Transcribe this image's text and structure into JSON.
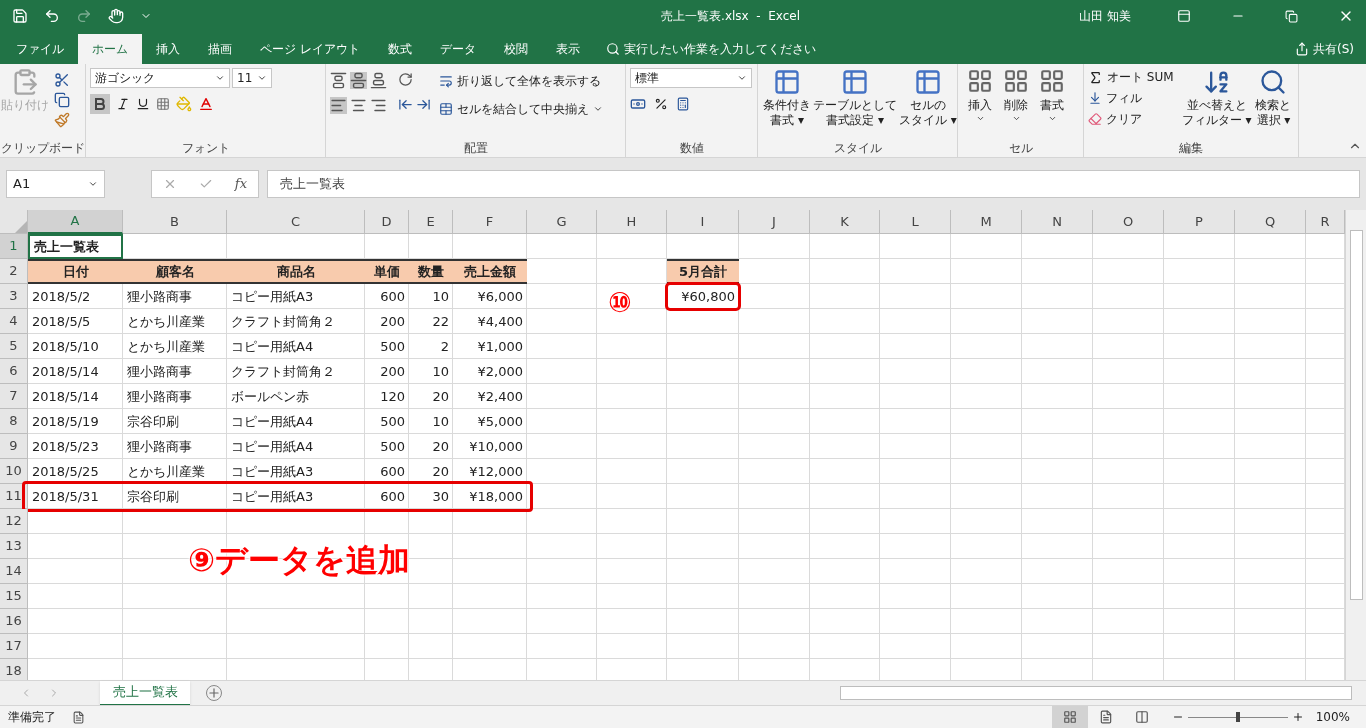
{
  "window": {
    "title": "売上一覧表.xlsx  -  Excel",
    "user": "山田 知美"
  },
  "menu_tabs": [
    {
      "label": "ファイル",
      "selected": false
    },
    {
      "label": "ホーム",
      "selected": true
    },
    {
      "label": "挿入",
      "selected": false
    },
    {
      "label": "描画",
      "selected": false
    },
    {
      "label": "ページ レイアウト",
      "selected": false
    },
    {
      "label": "数式",
      "selected": false
    },
    {
      "label": "データ",
      "selected": false
    },
    {
      "label": "校閲",
      "selected": false
    },
    {
      "label": "表示",
      "selected": false
    }
  ],
  "tell_me": "実行したい作業を入力してください",
  "share": "共有(S)",
  "ribbon": {
    "clipboard": {
      "paste": "貼り付け",
      "paste_disabled": true,
      "label": "クリップボード"
    },
    "font": {
      "name": "游ゴシック",
      "size": "11",
      "bold": true,
      "label": "フォント"
    },
    "alignment": {
      "wrap": "折り返して全体を表示する",
      "merge": "セルを結合して中央揃え",
      "label": "配置"
    },
    "number": {
      "format": "標準",
      "label": "数値"
    },
    "styles": {
      "buttons": [
        [
          "条件付き",
          "書式 ▾"
        ],
        [
          "テーブルとして",
          "書式設定 ▾"
        ],
        [
          "セルの",
          "スタイル ▾"
        ]
      ],
      "label": "スタイル"
    },
    "cells": {
      "buttons": [
        "挿入",
        "削除",
        "書式"
      ],
      "label": "セル"
    },
    "editing": {
      "autosum": "オート SUM",
      "fill": "フィル",
      "clear": "クリア",
      "sort": [
        "並べ替えと",
        "フィルター ▾"
      ],
      "find": [
        "検索と",
        "選択 ▾"
      ],
      "label": "編集"
    }
  },
  "formula_bar": {
    "name_box": "A1",
    "function_label": "fx",
    "formula": "売上一覧表"
  },
  "columns": [
    {
      "label": "A",
      "selected": true
    },
    {
      "label": "B",
      "selected": false
    },
    {
      "label": "C",
      "selected": false
    },
    {
      "label": "D",
      "selected": false
    },
    {
      "label": "E",
      "selected": false
    },
    {
      "label": "F",
      "selected": false
    },
    {
      "label": "G",
      "selected": false
    },
    {
      "label": "H",
      "selected": false
    },
    {
      "label": "I",
      "selected": false
    },
    {
      "label": "J",
      "selected": false
    },
    {
      "label": "K",
      "selected": false
    },
    {
      "label": "L",
      "selected": false
    },
    {
      "label": "M",
      "selected": false
    },
    {
      "label": "N",
      "selected": false
    },
    {
      "label": "O",
      "selected": false
    },
    {
      "label": "P",
      "selected": false
    },
    {
      "label": "Q",
      "selected": false
    },
    {
      "label": "R",
      "selected": false
    }
  ],
  "rows": [
    {
      "number": "1",
      "kind": "title",
      "selected": true,
      "highlighted": false,
      "cells": [
        "売上一覧表"
      ]
    },
    {
      "number": "2",
      "kind": "header",
      "selected": false,
      "highlighted": false,
      "cells": [
        "日付",
        "顧客名",
        "商品名",
        "単価",
        "数量",
        "売上金額"
      ]
    },
    {
      "number": "3",
      "kind": "data",
      "selected": false,
      "highlighted": false,
      "cells": [
        "2018/5/2",
        "狸小路商事",
        "コピー用紙A3",
        "600",
        "10",
        "¥6,000"
      ]
    },
    {
      "number": "4",
      "kind": "data",
      "selected": false,
      "highlighted": false,
      "cells": [
        "2018/5/5",
        "とかち川産業",
        "クラフト封筒角２",
        "200",
        "22",
        "¥4,400"
      ]
    },
    {
      "number": "5",
      "kind": "data",
      "selected": false,
      "highlighted": false,
      "cells": [
        "2018/5/10",
        "とかち川産業",
        "コピー用紙A4",
        "500",
        "2",
        "¥1,000"
      ]
    },
    {
      "number": "6",
      "kind": "data",
      "selected": false,
      "highlighted": false,
      "cells": [
        "2018/5/14",
        "狸小路商事",
        "クラフト封筒角２",
        "200",
        "10",
        "¥2,000"
      ]
    },
    {
      "number": "7",
      "kind": "data",
      "selected": false,
      "highlighted": false,
      "cells": [
        "2018/5/14",
        "狸小路商事",
        "ボールペン赤",
        "120",
        "20",
        "¥2,400"
      ]
    },
    {
      "number": "8",
      "kind": "data",
      "selected": false,
      "highlighted": false,
      "cells": [
        "2018/5/19",
        "宗谷印刷",
        "コピー用紙A4",
        "500",
        "10",
        "¥5,000"
      ]
    },
    {
      "number": "9",
      "kind": "data",
      "selected": false,
      "highlighted": false,
      "cells": [
        "2018/5/23",
        "狸小路商事",
        "コピー用紙A4",
        "500",
        "20",
        "¥10,000"
      ]
    },
    {
      "number": "10",
      "kind": "data",
      "selected": false,
      "highlighted": false,
      "cells": [
        "2018/5/25",
        "とかち川産業",
        "コピー用紙A3",
        "600",
        "20",
        "¥12,000"
      ]
    },
    {
      "number": "11",
      "kind": "data",
      "selected": false,
      "highlighted": true,
      "cells": [
        "2018/5/31",
        "宗谷印刷",
        "コピー用紙A3",
        "600",
        "30",
        "¥18,000"
      ]
    },
    {
      "number": "12",
      "kind": "data",
      "selected": false,
      "highlighted": false,
      "cells": []
    },
    {
      "number": "13",
      "kind": "data",
      "selected": false,
      "highlighted": false,
      "cells": []
    },
    {
      "number": "14",
      "kind": "data",
      "selected": false,
      "highlighted": false,
      "cells": []
    },
    {
      "number": "15",
      "kind": "data",
      "selected": false,
      "highlighted": false,
      "cells": []
    },
    {
      "number": "16",
      "kind": "data",
      "selected": false,
      "highlighted": false,
      "cells": []
    },
    {
      "number": "17",
      "kind": "data",
      "selected": false,
      "highlighted": false,
      "cells": []
    },
    {
      "number": "18",
      "kind": "data",
      "selected": false,
      "highlighted": false,
      "cells": []
    }
  ],
  "summary": {
    "header": "5月合計",
    "value": "¥60,800",
    "highlighted": true
  },
  "step_labels": [
    {
      "text": "⑨データを追加"
    },
    {
      "text": "⑩"
    }
  ],
  "sheet_tabs": [
    {
      "label": "売上一覧表",
      "selected": true
    }
  ],
  "status_bar": {
    "text": "準備完了",
    "views": [
      {
        "selected": true
      },
      {
        "selected": false
      },
      {
        "selected": false
      }
    ],
    "zoom": {
      "level": 0.5,
      "text": "100%"
    }
  }
}
